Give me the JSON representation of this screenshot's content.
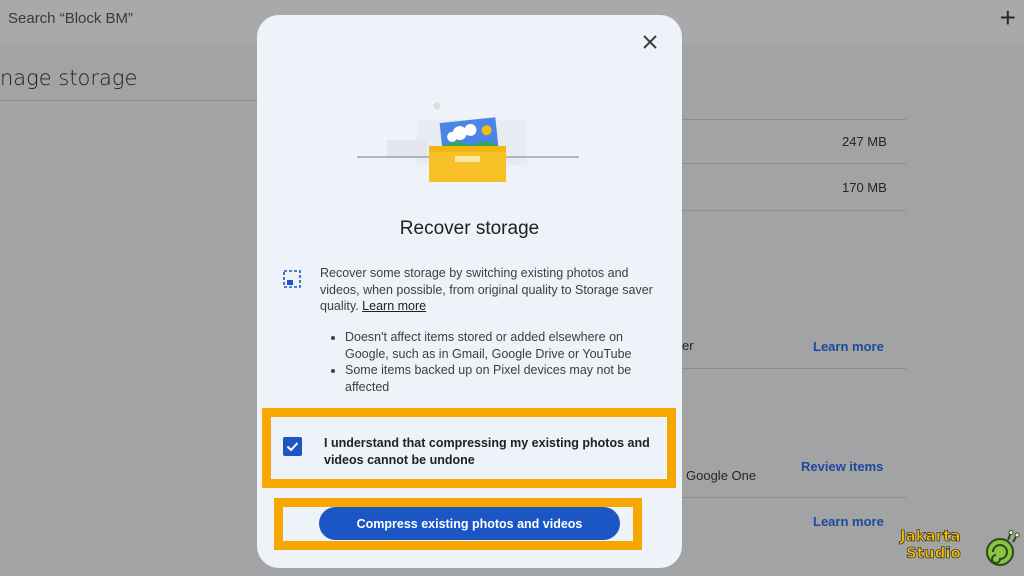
{
  "background": {
    "search_text": "Search “Block BM”",
    "page_title": "nage storage",
    "rows": [
      {
        "text": "247 MB"
      },
      {
        "text": "170 MB"
      }
    ],
    "partial_text_1": "er",
    "link_1": "Learn more",
    "partial_text_2": "Google One",
    "link_2": "Review items",
    "link_3": "Learn more"
  },
  "dialog": {
    "title": "Recover storage",
    "description": "Recover some storage by switching existing photos and videos, when possible, from original quality to Storage saver quality.",
    "learn_more": "Learn more",
    "bullets": [
      "Doesn't affect items stored or added elsewhere on Google, such as in Gmail, Google Drive or YouTube",
      "Some items backed up on Pixel devices may not be affected"
    ],
    "checkbox_label": "I understand that compressing my existing photos and videos cannot be undone",
    "checkbox_checked": true,
    "compress_button": "Compress existing photos and videos"
  },
  "watermark": {
    "line1": "Jakarta",
    "line2": "Studio"
  },
  "colors": {
    "accent": "#1a56c4",
    "highlight": "#f7a800",
    "dialog_bg": "#eef2f9"
  }
}
